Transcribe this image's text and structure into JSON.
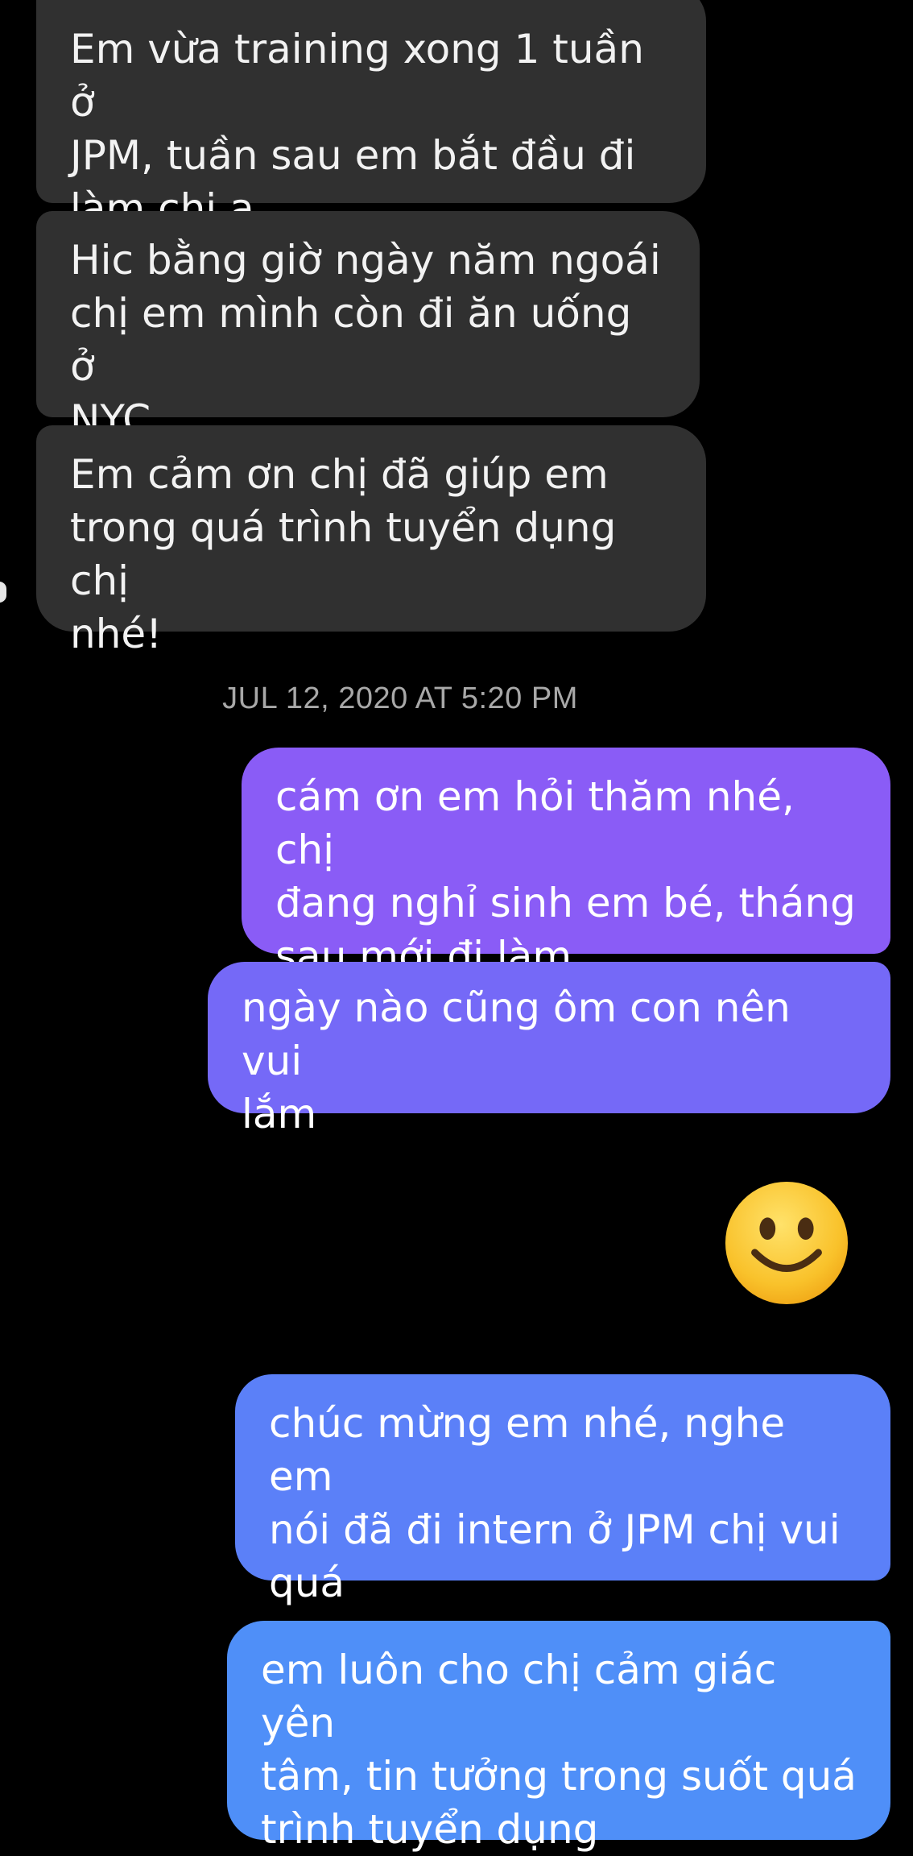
{
  "conversation": {
    "received_messages": [
      "Em vừa training xong 1 tuần ở\nJPM, tuần sau em bắt đầu đi\nlàm chị ạ",
      "Hic bằng giờ ngày năm ngoái\nchị em mình còn đi ăn uống ở\nNYC...",
      "Em cảm ơn chị đã giúp em\ntrong quá trình tuyển dụng chị\nnhé!"
    ],
    "timestamp": "JUL 12, 2020 AT 5:20 PM",
    "sent_messages": [
      "cám ơn em hỏi thăm nhé, chị\nđang nghỉ sinh em bé, tháng\nsau mới đi làm",
      "ngày nào cũng ôm con nên vui\nlắm",
      "chúc mừng em nhé, nghe em\nnói đã đi intern ở JPM chị vui\nquá",
      "em luôn cho chị cảm giác yên\ntâm, tin tưởng trong suốt quá\ntrình tuyển dụng"
    ],
    "emoji": {
      "icon": "slightly-smiling-face-emoji"
    }
  },
  "colors": {
    "background": "#000000",
    "received_bubble": "#303030",
    "sent_gradient_top": "#8a5cf6",
    "sent_gradient_bottom": "#4f8ff8"
  }
}
